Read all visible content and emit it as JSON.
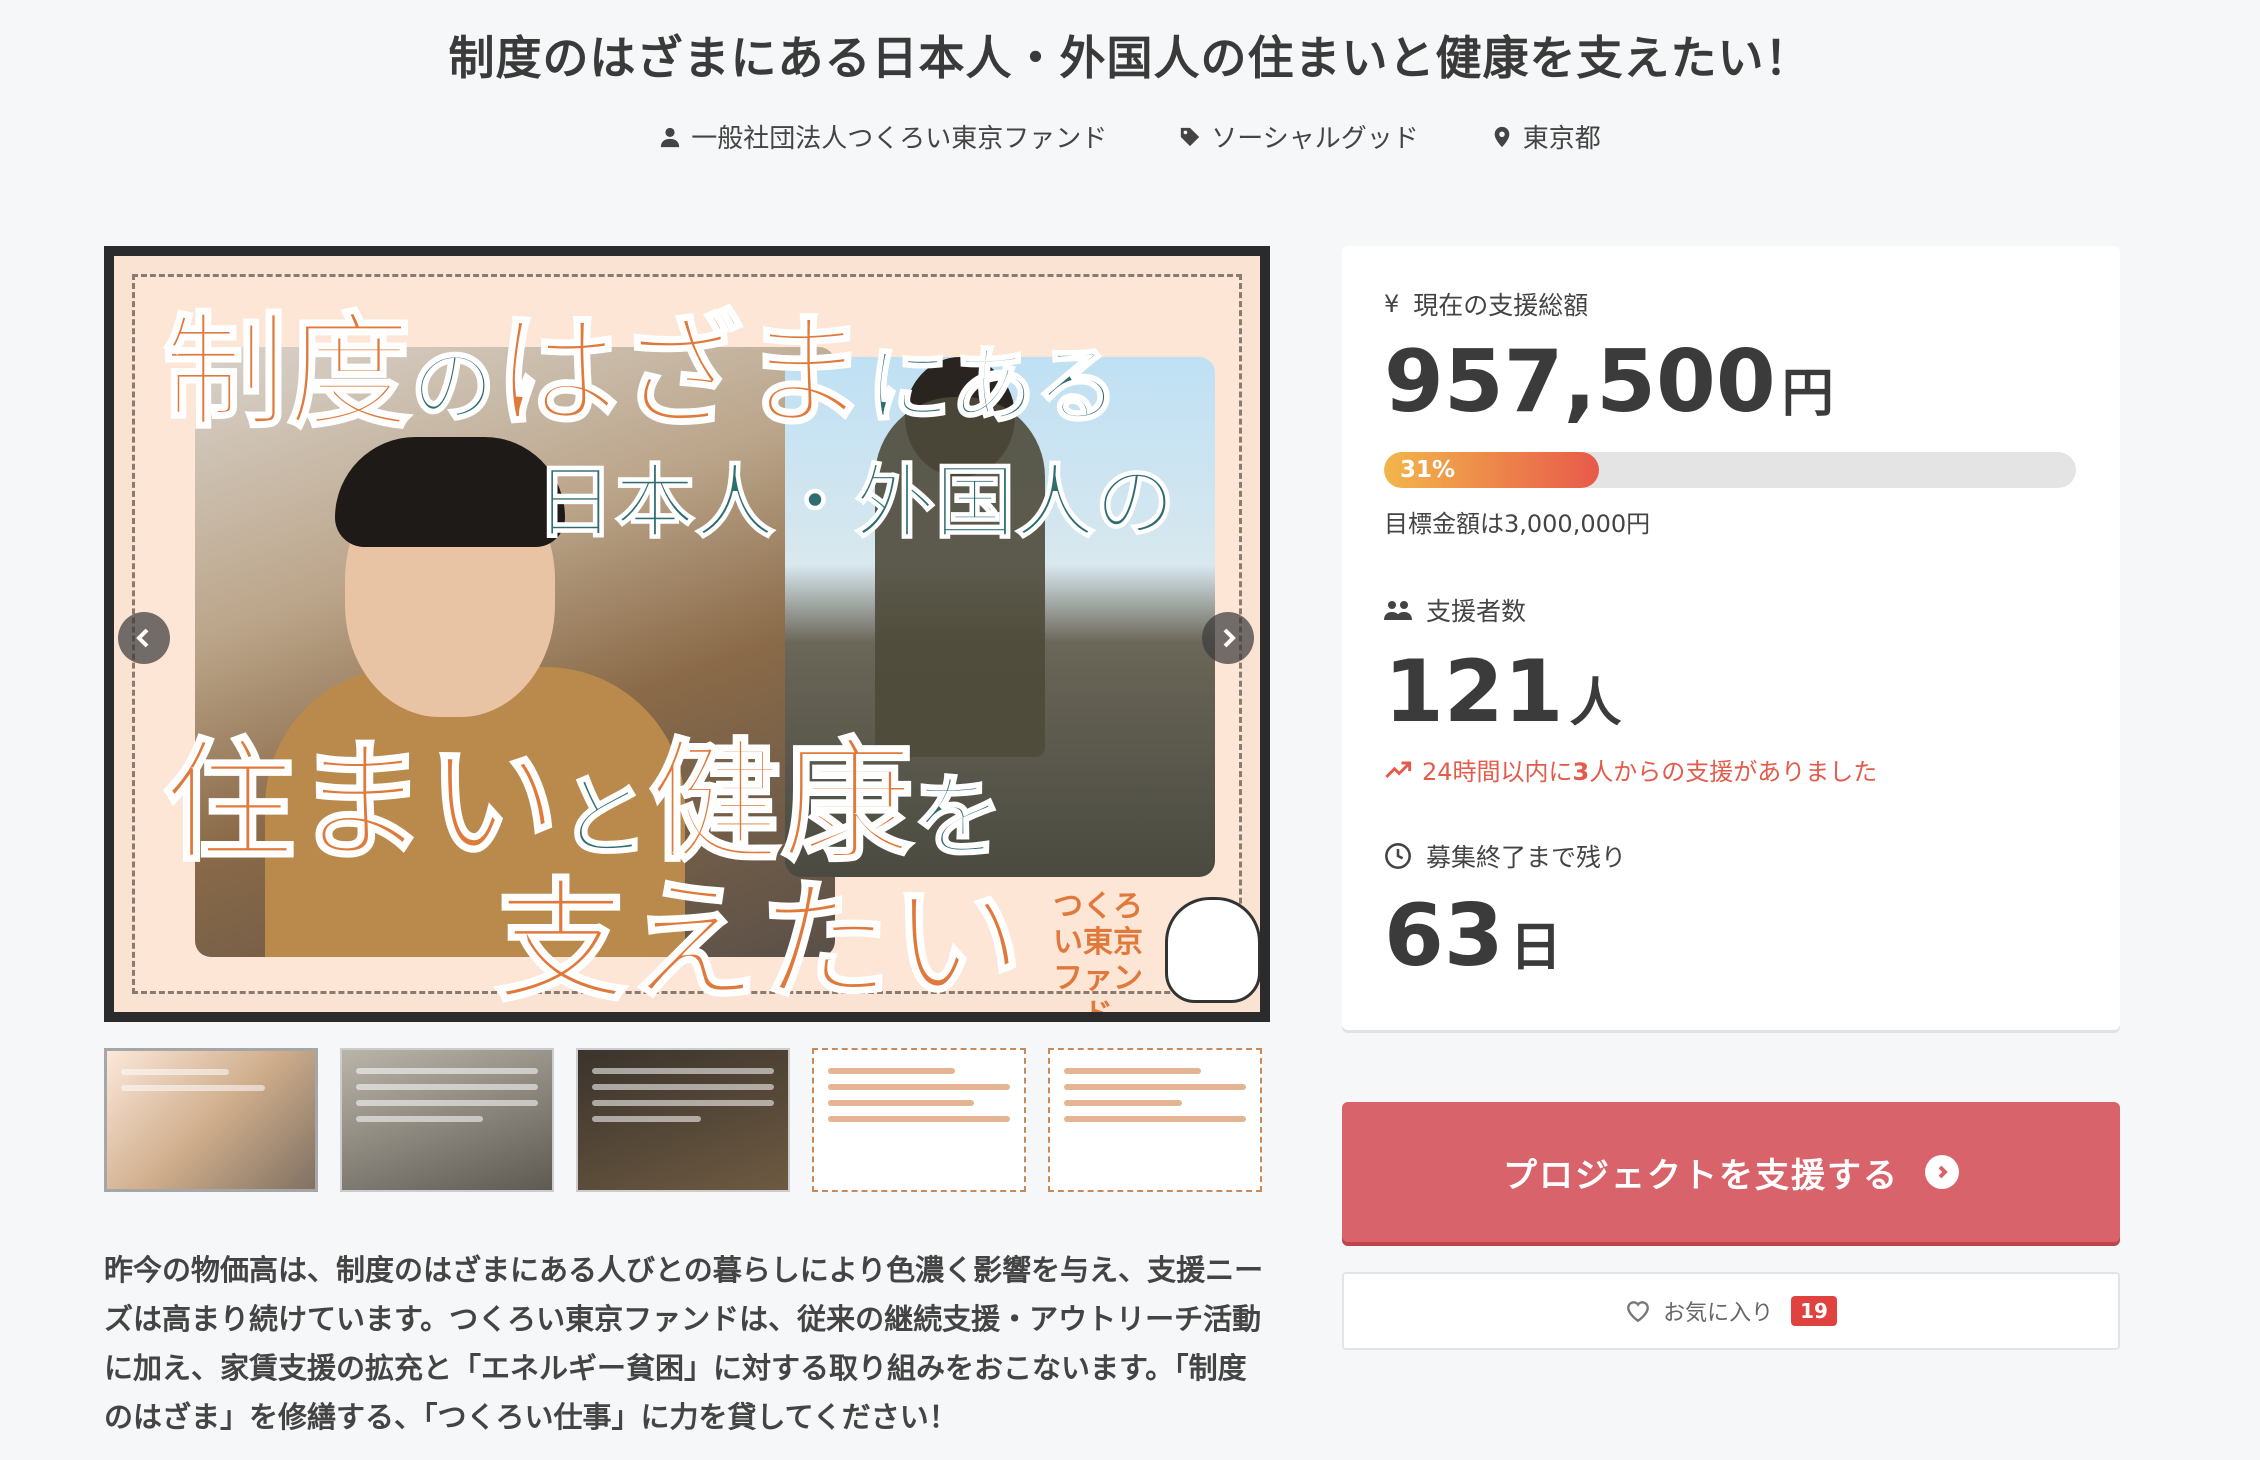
{
  "page": {
    "title": "制度のはざまにある日本人・外国人の住まいと健康を支えたい！",
    "meta": {
      "organizer": "一般社団法人つくろい東京ファンド",
      "category": "ソーシャルグッド",
      "location": "東京都"
    }
  },
  "hero": {
    "text_line1_a": "制度",
    "text_line1_b": "の",
    "text_line1_c": "はざま",
    "text_line1_d": "にある",
    "text_line2": "日本人・外国人の",
    "text_line3_a": "住まい",
    "text_line3_b": "と",
    "text_line3_c": "健康",
    "text_line3_d": "を",
    "text_line4": "支えたい",
    "logo_text": "つくろい東京ファンド"
  },
  "thumbnails": [
    {
      "label": "thumbnail-1"
    },
    {
      "label": "thumbnail-2"
    },
    {
      "label": "thumbnail-3"
    },
    {
      "label": "thumbnail-4"
    },
    {
      "label": "thumbnail-5"
    }
  ],
  "description": "昨今の物価高は、制度のはざまにある人びとの暮らしにより色濃く影響を与え、支援ニーズは高まり続けています。つくろい東京ファンドは、従来の継続支援・アウトリーチ活動に加え、家賃支援の拡充と「エネルギー貧困」に対する取り組みをおこないます。「制度のはざま」を修繕する、「つくろい仕事」に力を貸してください！",
  "stats": {
    "amount_label": "現在の支援総額",
    "amount_value": "957,500",
    "amount_unit": "円",
    "progress_percent": 31,
    "progress_label": "31%",
    "goal_text": "目標金額は3,000,000円",
    "supporters_label": "支援者数",
    "supporters_value": "121",
    "supporters_unit": "人",
    "recent_prefix": "24時間以内に",
    "recent_count": "3",
    "recent_suffix": "人からの支援がありました",
    "remaining_label": "募集終了まで残り",
    "remaining_value": "63",
    "remaining_unit": "日"
  },
  "actions": {
    "support_button": "プロジェクトを支援する",
    "favorite_label": "お気に入り",
    "favorite_count": "19"
  },
  "colors": {
    "accent": "#d9636a",
    "progress_start": "#f2b64a",
    "progress_end": "#e85a4a",
    "recent_text": "#e25b4b",
    "badge": "#e0433f"
  }
}
